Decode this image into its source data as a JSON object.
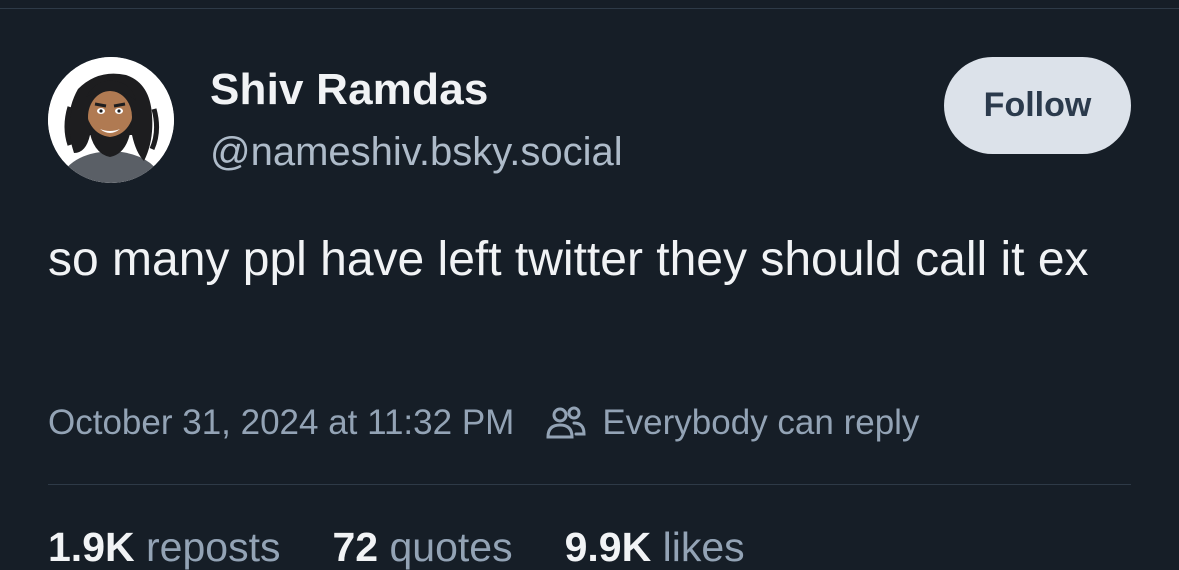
{
  "author": {
    "display_name": "Shiv Ramdas",
    "handle": "@nameshiv.bsky.social",
    "avatar_icon": "cartoon-bearded-man-avatar"
  },
  "actions": {
    "follow_label": "Follow"
  },
  "post": {
    "text": "so many ppl have left twitter they should call it ex",
    "timestamp": "October 31, 2024 at 11:32 PM",
    "reply_setting": "Everybody can reply",
    "reply_setting_icon": "people-icon"
  },
  "stats": {
    "reposts": {
      "count": "1.9K",
      "label": "reposts"
    },
    "quotes": {
      "count": "72",
      "label": "quotes"
    },
    "likes": {
      "count": "9.9K",
      "label": "likes"
    }
  },
  "colors": {
    "background": "#161e27",
    "text_primary": "#f1f3f5",
    "text_secondary": "#93a3b5",
    "follow_button_bg": "#dce2ea",
    "follow_button_text": "#2b3a4c"
  }
}
